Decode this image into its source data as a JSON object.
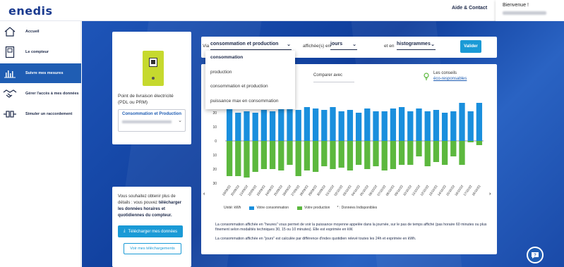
{
  "header": {
    "logo": "enedis",
    "help": "Aide & Contact",
    "welcome": "Bienvenue !"
  },
  "sidebar": {
    "items": [
      {
        "label": "Accueil",
        "icon": "home-icon"
      },
      {
        "label": "Le compteur",
        "icon": "meter-icon"
      },
      {
        "label": "Suivre mes mesures",
        "icon": "bar-chart-icon"
      },
      {
        "label": "Gérer l'accès à mes données",
        "icon": "handshake-icon"
      },
      {
        "label": "Simuler un raccordement",
        "icon": "plug-icon"
      }
    ],
    "active_index": 2
  },
  "pdl_card": {
    "title": "Point de livraison électricité (PDL ou PRM)",
    "select_label": "Consommation et Production"
  },
  "download_card": {
    "text_before": "Vous souhaitez obtenir plus de détails : vous pouvez ",
    "text_bold": "télécharger les données horaires et quotidiennes du compteur.",
    "download_button": "Télécharger mes données",
    "see_button": "Voir mes téléchargements"
  },
  "controls": {
    "prefix_via": "Via",
    "data_select": "consommation et production",
    "displayed_in": "affichée(s) en",
    "unit_select": "jours",
    "as": "et en",
    "chart_select": "histogrammes",
    "validate": "Valider"
  },
  "dropdown": {
    "options": [
      "consommation",
      "production",
      "consommation et production",
      "puissance max en consommation"
    ]
  },
  "compare": "Comparer avec",
  "tips": {
    "label": "Les conseils",
    "link": "éco-responsables"
  },
  "legend": {
    "unit": "Unité: kWh",
    "consumption": "Votre consommation",
    "production": "Votre production",
    "unavailable": "* : Données Indisponibles"
  },
  "notes": [
    "La consommation affichée en \"heures\" vous permet de voir la puissance moyenne appelée dans la journée, sur le pas de temps affiché (pas horaire 60 minutes ou plus finement selon modalités techniques 30, 15 ou 10 minutes). Elle est exprimée en kW.",
    "La consommation affichée en \"jours\" est calculée par différence d'index quotidien relevé toutes les 24h et exprimée en kWh."
  ],
  "colors": {
    "consumption": "#1a8fdd",
    "production": "#5cb83e",
    "accent": "#1a9ad6",
    "brand": "#1a3a8f"
  },
  "chart_data": {
    "type": "bar",
    "x": [
      "19/09/22",
      "20/09/22",
      "21/09/22",
      "22/09/22",
      "23/09/22",
      "24/09/22",
      "25/09/22",
      "26/09/22",
      "27/09/22",
      "28/09/22",
      "29/09/22",
      "30/09/22",
      "01/10/22",
      "02/10/22",
      "03/10/22",
      "04/10/22",
      "05/10/22",
      "06/10/22",
      "07/10/22",
      "08/10/22",
      "09/10/22",
      "10/10/22",
      "11/10/22",
      "12/10/22",
      "13/10/22",
      "14/10/22",
      "15/10/22",
      "16/10/22",
      "17/10/22",
      "18/10/22"
    ],
    "series": [
      {
        "name": "Votre consommation",
        "values": [
          23,
          20,
          21,
          20,
          22,
          21,
          23,
          24,
          22,
          24,
          23,
          22,
          24,
          21,
          22,
          20,
          23,
          21,
          21,
          23,
          24,
          21,
          23,
          21,
          22,
          20,
          21,
          27,
          21,
          27
        ]
      },
      {
        "name": "Votre production",
        "values": [
          -25,
          -25,
          -26,
          -22,
          -20,
          -20,
          -21,
          -17,
          -25,
          -21,
          -22,
          -18,
          -20,
          -19,
          -21,
          -17,
          -20,
          -18,
          -21,
          -20,
          -17,
          -17,
          -11,
          -18,
          -15,
          -17,
          -11,
          -17,
          -1,
          -3
        ]
      }
    ],
    "ylim": [
      -30,
      30
    ],
    "y_ticks": [
      30,
      20,
      10,
      0,
      10,
      20,
      30
    ],
    "grid": false
  }
}
